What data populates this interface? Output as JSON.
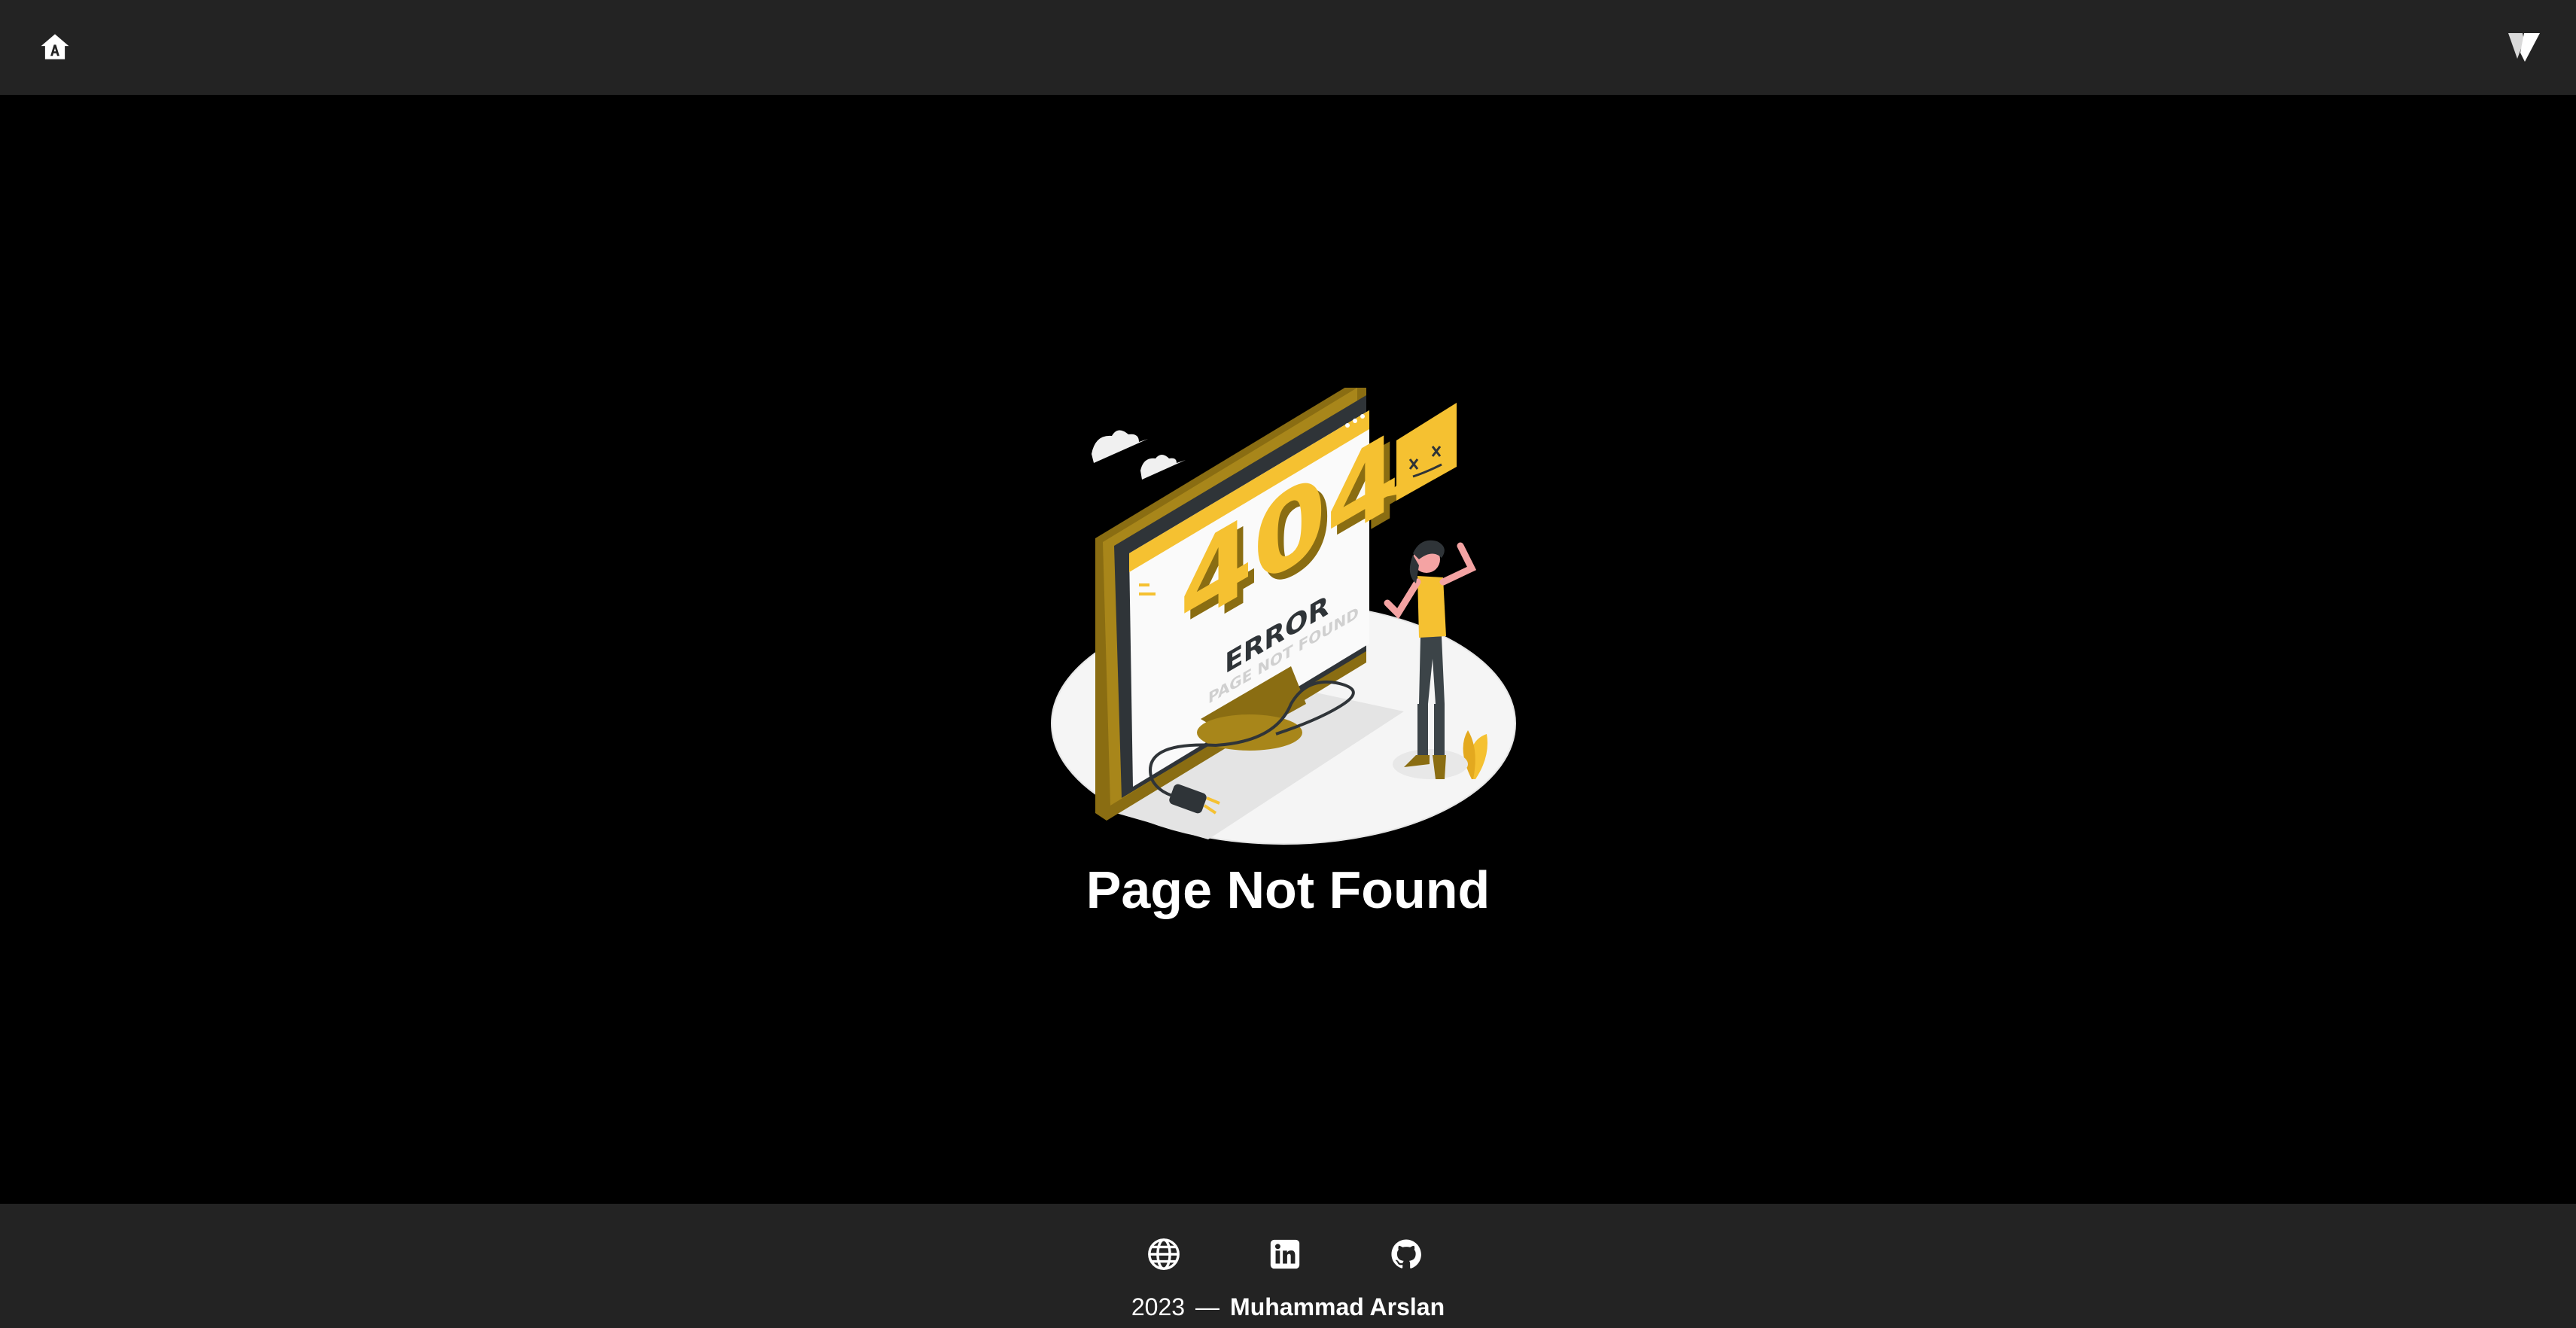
{
  "header": {
    "home_icon": "home-icon",
    "brand_icon": "vuetify-logo-icon"
  },
  "main": {
    "illustration_text": {
      "code": "404",
      "label": "ERROR",
      "sublabel": "PAGE NOT FOUND"
    },
    "title": "Page Not Found"
  },
  "footer": {
    "socials": [
      {
        "icon": "globe-icon"
      },
      {
        "icon": "linkedin-icon"
      },
      {
        "icon": "github-icon"
      }
    ],
    "year": "2023",
    "separator": "—",
    "author": "Muhammad Arslan"
  },
  "colors": {
    "header_bg": "#232323",
    "page_bg": "#000000",
    "accent_yellow": "#F5C131",
    "accent_dark_gold": "#8A6D12",
    "text": "#FFFFFF"
  }
}
